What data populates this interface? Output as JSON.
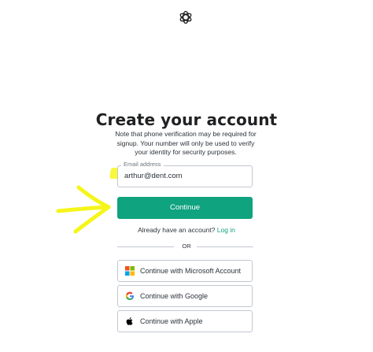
{
  "header": {
    "logo_icon": "openai-logo-icon"
  },
  "signup": {
    "title": "Create your account",
    "subtitle": "Note that phone verification may be required for signup. Your number will only be used to verify your identity for security purposes.",
    "email": {
      "label": "Email address",
      "value": "arthur@dent.com"
    },
    "continue_label": "Continue",
    "login_prompt": "Already have an account?",
    "login_link": "Log in",
    "divider_text": "OR",
    "providers": [
      {
        "label": "Continue with Microsoft Account",
        "icon": "microsoft-icon"
      },
      {
        "label": "Continue with Google",
        "icon": "google-icon"
      },
      {
        "label": "Continue with Apple",
        "icon": "apple-icon"
      }
    ]
  },
  "annotation": {
    "color": "#f5f51a"
  },
  "colors": {
    "accent": "#10a37f",
    "border": "#c2c8d0",
    "text": "#2d333a"
  }
}
